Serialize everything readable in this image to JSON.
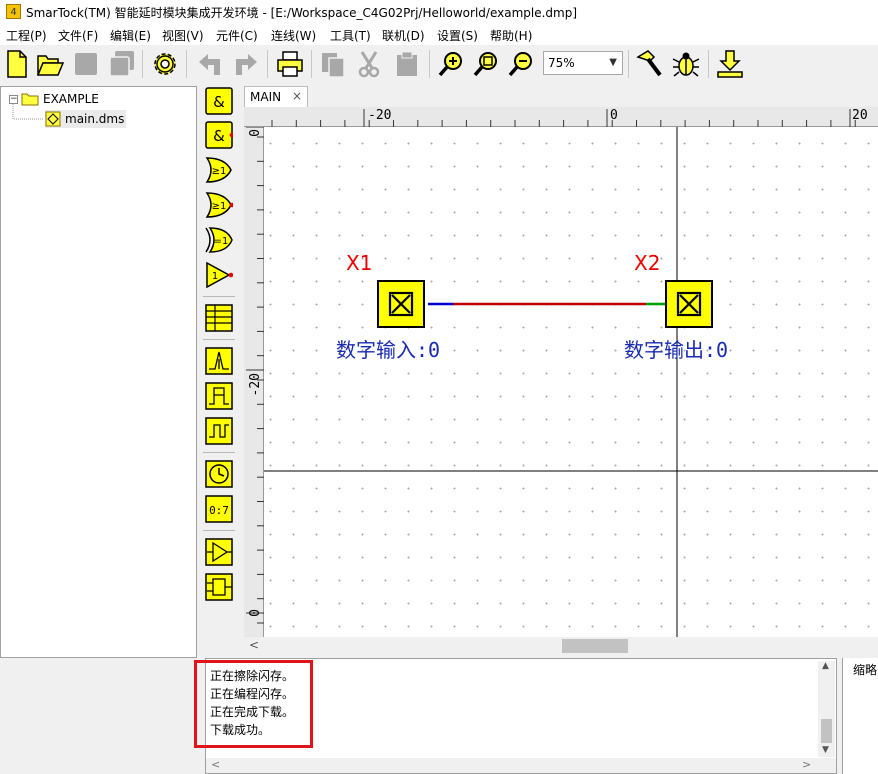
{
  "window": {
    "title": "SmarTock(TM) 智能延时模块集成开发环境 - [E:/Workspace_C4G02Prj/Helloworld/example.dmp]",
    "app_icon_glyph": "4"
  },
  "menu": {
    "items": [
      "工程(P)",
      "文件(F)",
      "编辑(E)",
      "视图(V)",
      "元件(C)",
      "连线(W)",
      "工具(T)",
      "联机(D)",
      "设置(S)",
      "帮助(H)"
    ]
  },
  "toolbar": {
    "zoom_value": "75%"
  },
  "project_tree": {
    "root_label": "EXAMPLE",
    "root_expander": "−",
    "child_label": "main.dms"
  },
  "tabs": {
    "main_label": "MAIN",
    "close_glyph": "×"
  },
  "ruler": {
    "top_labels": [
      "-20",
      "0",
      "20"
    ],
    "left_labels": [
      "0",
      "-20",
      "0"
    ]
  },
  "canvas": {
    "blocks": [
      {
        "id": "X1",
        "name": "数字输入:0"
      },
      {
        "id": "X2",
        "name": "数字输出:0"
      }
    ]
  },
  "output": {
    "lines": [
      "正在擦除闪存。",
      "正在编程闪存。",
      "正在完成下载。",
      "下载成功。"
    ]
  },
  "thumbnail_panel": {
    "label": "缩略"
  },
  "colors": {
    "highlight": "#e0141a",
    "block_fill": "#ffff00",
    "label_id": "#ee0000",
    "label_name": "#1a2bb0",
    "wire": "#c00000"
  }
}
